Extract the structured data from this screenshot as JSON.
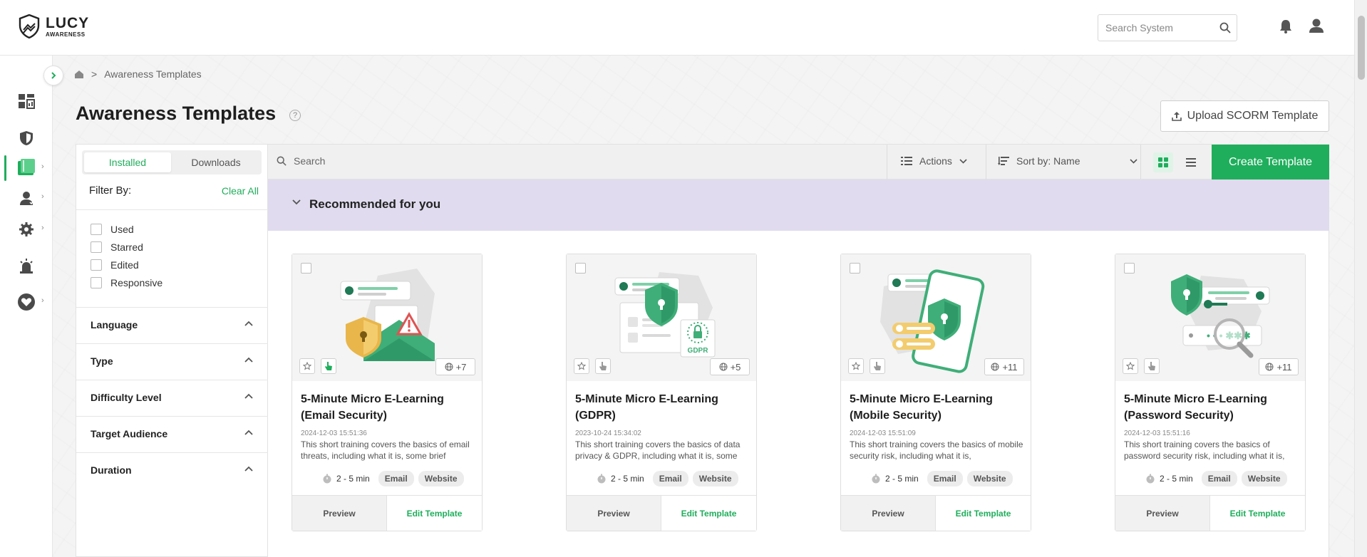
{
  "brand": {
    "name": "LUCY",
    "tagline": "AWARENESS"
  },
  "header": {
    "search_placeholder": "Search System"
  },
  "breadcrumb": {
    "separator": ">",
    "current": "Awareness Templates"
  },
  "page": {
    "title": "Awareness Templates",
    "help": "?",
    "upload_label": "Upload SCORM Template"
  },
  "sidebar": {
    "items": [
      {
        "name": "dashboard",
        "icon": "dashboard-icon",
        "has_submenu": false
      },
      {
        "name": "security",
        "icon": "shield-icon",
        "has_submenu": false
      },
      {
        "name": "awareness",
        "icon": "awareness-templates-icon",
        "has_submenu": true,
        "active": true
      },
      {
        "name": "users",
        "icon": "user-group-icon",
        "has_submenu": true
      },
      {
        "name": "settings",
        "icon": "gear-icon",
        "has_submenu": true
      },
      {
        "name": "alerts",
        "icon": "siren-icon",
        "has_submenu": false
      },
      {
        "name": "support",
        "icon": "heart-icon",
        "has_submenu": true
      }
    ]
  },
  "filters": {
    "tabs": {
      "installed": "Installed",
      "downloads": "Downloads"
    },
    "filter_by": "Filter By:",
    "clear_all": "Clear All",
    "checkboxes": [
      "Used",
      "Starred",
      "Edited",
      "Responsive"
    ],
    "sections": [
      "Language",
      "Type",
      "Difficulty Level",
      "Target Audience",
      "Duration"
    ]
  },
  "toolbar": {
    "search_placeholder": "Search",
    "actions": "Actions",
    "sort": "Sort by: Name",
    "create": "Create Template"
  },
  "recommended": {
    "title": "Recommended for you"
  },
  "cards": [
    {
      "title": "5-Minute Micro E-Learning (Email Security)",
      "date": "2024-12-03 15:51:36",
      "description": "This short training covers the basics of email threats, including what it is, some brief",
      "duration": "2 - 5 min",
      "tags": [
        "Email",
        "Website"
      ],
      "languages": "+7",
      "preview": "Preview",
      "edit": "Edit Template"
    },
    {
      "title": "5-Minute Micro E-Learning (GDPR)",
      "date": "2023-10-24 15:34:02",
      "description": "This short training covers the basics of data privacy & GDPR, including what it is, some",
      "duration": "2 - 5 min",
      "tags": [
        "Email",
        "Website"
      ],
      "languages": "+5",
      "preview": "Preview",
      "edit": "Edit Template",
      "thumb_label": "GDPR"
    },
    {
      "title": "5-Minute Micro E-Learning (Mobile Security)",
      "date": "2024-12-03 15:51:09",
      "description": "This short training covers the basics of mobile security risk, including what it is,",
      "duration": "2 - 5 min",
      "tags": [
        "Email",
        "Website"
      ],
      "languages": "+11",
      "preview": "Preview",
      "edit": "Edit Template"
    },
    {
      "title": "5-Minute Micro E-Learning (Password Security)",
      "date": "2024-12-03 15:51:16",
      "description": "This short training covers the basics of password security risk, including what it is,",
      "duration": "2 - 5 min",
      "tags": [
        "Email",
        "Website"
      ],
      "languages": "+11",
      "preview": "Preview",
      "edit": "Edit Template"
    }
  ],
  "colors": {
    "accent": "#1fae5c",
    "recommended_bg": "#e0dbee",
    "text": "#222222"
  }
}
